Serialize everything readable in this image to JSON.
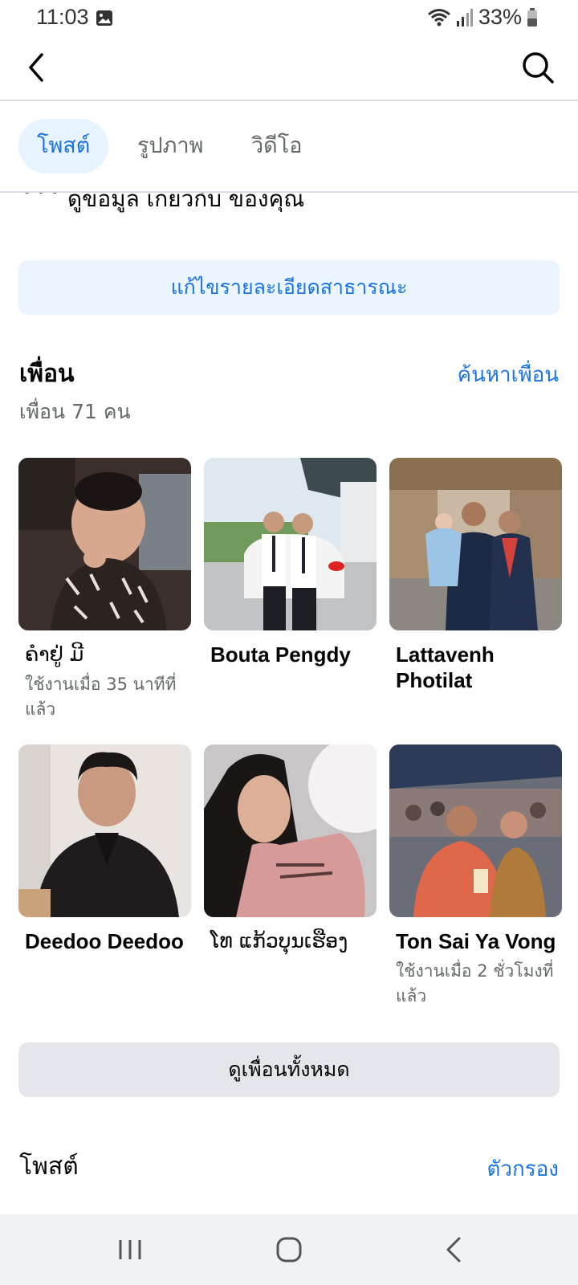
{
  "status_bar": {
    "time": "11:03",
    "battery": "33%"
  },
  "tabs": [
    {
      "label": "โพสต์",
      "active": true
    },
    {
      "label": "รูปภาพ",
      "active": false
    },
    {
      "label": "วิดีโอ",
      "active": false
    }
  ],
  "cutoff_text": "ดูข้อมูล เกี่ยวกับ ของคุณ",
  "edit_public_details": "แก้ไขรายละเอียดสาธารณะ",
  "friends": {
    "title": "เพื่อน",
    "find_link": "ค้นหาเพื่อน",
    "count": "เพื่อน 71 คน",
    "list": [
      {
        "name": "ຄຳຢູ່ ມີ",
        "status": "ใช้งานเมื่อ 35 นาทีที่แล้ว"
      },
      {
        "name": "Bouta Pengdy",
        "status": ""
      },
      {
        "name": "Lattavenh Photilat",
        "status": ""
      },
      {
        "name": "Deedoo Deedoo",
        "status": ""
      },
      {
        "name": "ໂທ ແກ້ວບຸນເຮືອງ",
        "status": ""
      },
      {
        "name": "Ton Sai Ya Vong",
        "status": "ใช้งานเมื่อ 2 ชั่วโมงที่แล้ว"
      }
    ],
    "see_all": "ดูเพื่อนทั้งหมด"
  },
  "posts": {
    "title": "โพสต์",
    "filter": "ตัวกรอง"
  },
  "colors": {
    "accent": "#1b74e4",
    "accent_bg": "#ebf5ff",
    "secondary_text": "#65676b"
  }
}
